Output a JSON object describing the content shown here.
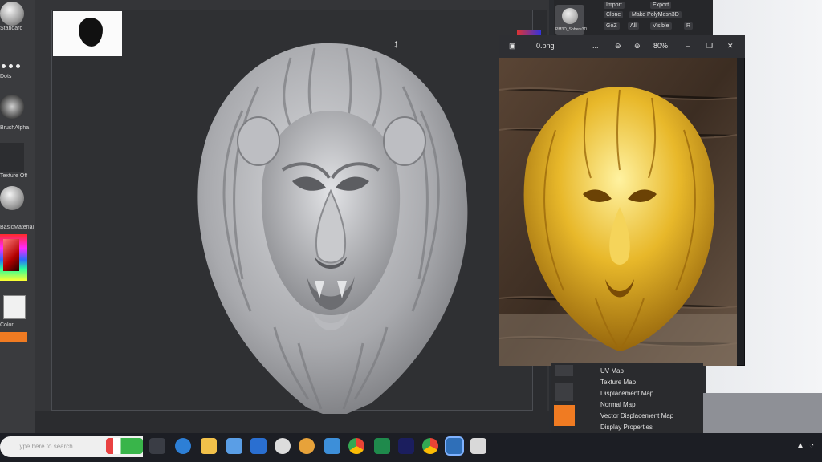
{
  "left_tray": {
    "labels": [
      "Standard",
      "Dots",
      "BrushAlpha",
      "Texture Off",
      "BasicMaterial Gray",
      "Color"
    ]
  },
  "right_panel": {
    "buttons": [
      "Import",
      "Export",
      "Clone",
      "Make PolyMesh3D",
      "GoZ",
      "All",
      "Visible",
      "R"
    ],
    "thumb_label": "PM3D_Sphere3D"
  },
  "viewer": {
    "filename": "0.png",
    "more": "...",
    "zoom": "80%",
    "minimize": "–",
    "restore": "❐",
    "close": "✕"
  },
  "bottom_menu": {
    "items": [
      "UV Map",
      "Texture Map",
      "Displacement Map",
      "Normal Map",
      "Vector Displacement Map",
      "Display Properties"
    ]
  },
  "taskbar": {
    "search_placeholder": "Type here to search"
  },
  "colors": {
    "accent_orange": "#f07b22",
    "viewport_bg": "#2f3033",
    "gold": "#e6b422"
  },
  "icons": [
    "search-icon",
    "zoom-in-icon",
    "zoom-out-icon",
    "image-icon",
    "edge-icon",
    "file-explorer-icon",
    "store-icon",
    "mail-icon",
    "chrome-icon",
    "excel-icon",
    "photoshop-icon",
    "word-icon"
  ]
}
